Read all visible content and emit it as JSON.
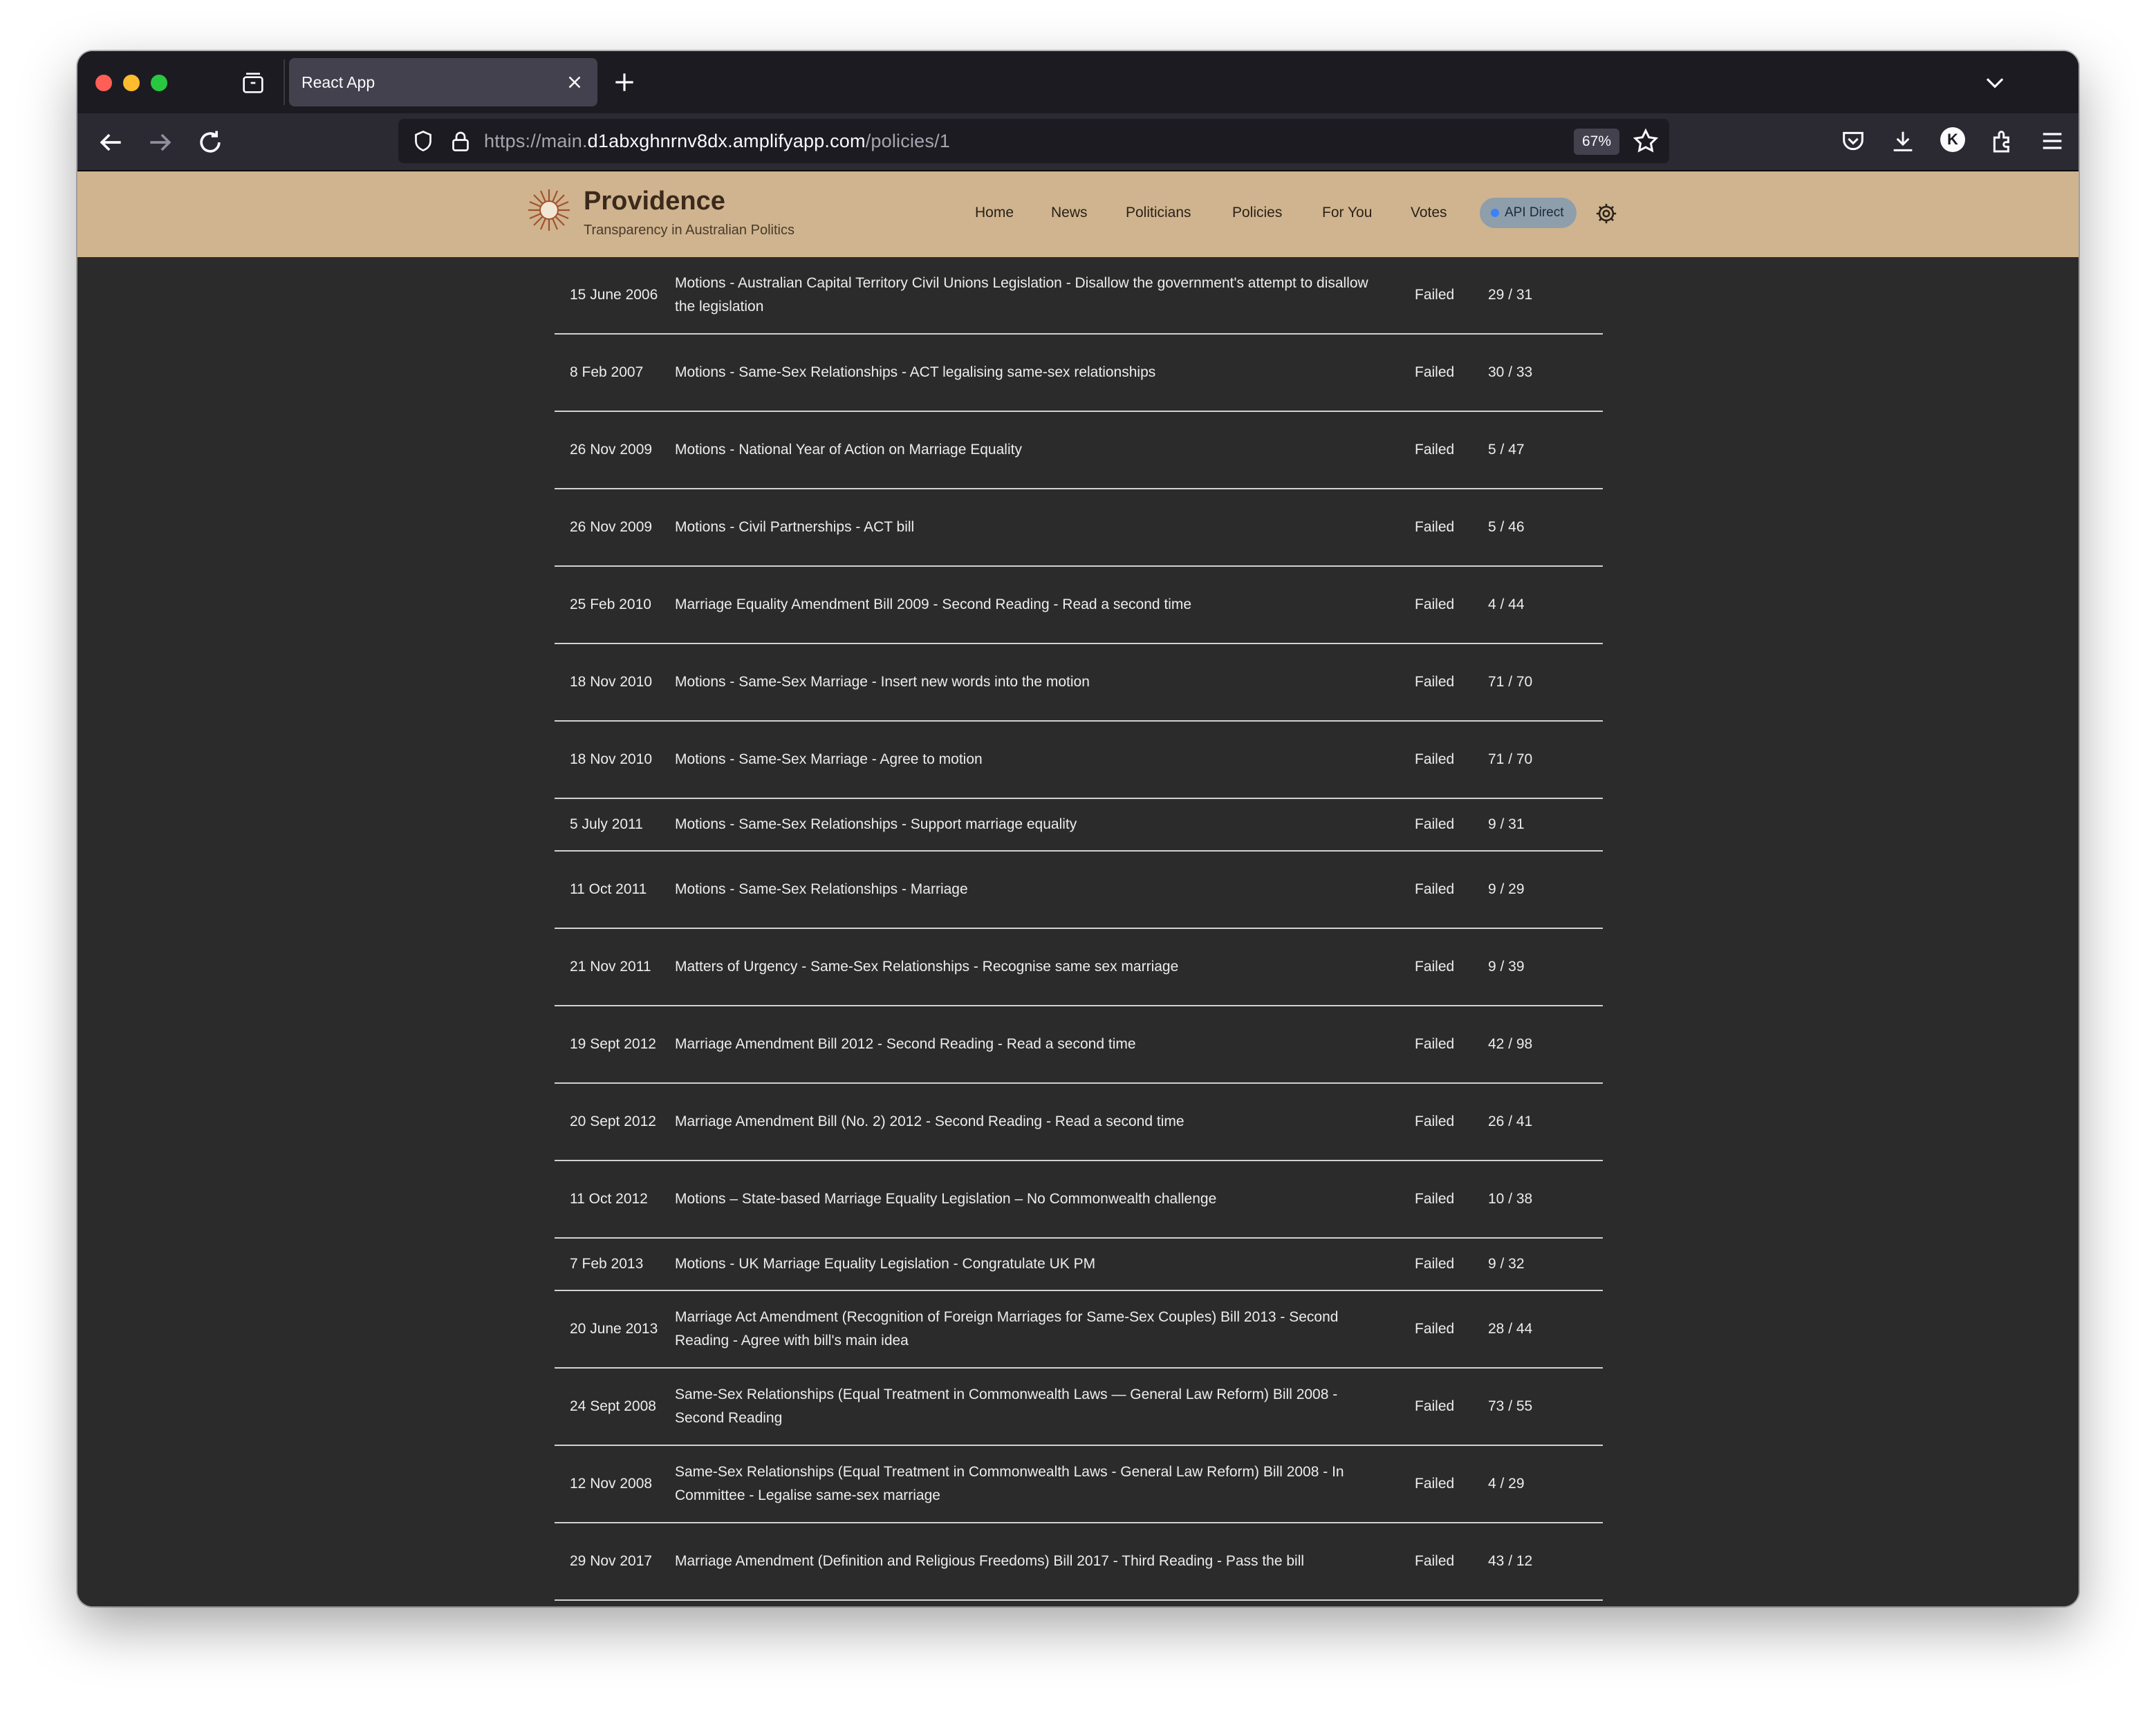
{
  "browser": {
    "tab_title": "React App",
    "url_prefix": "https://main.",
    "url_domain": "d1abxghnrnv8dx.amplifyapp.com",
    "url_path": "/policies/1",
    "zoom": "67%",
    "profile_initial": "K"
  },
  "site": {
    "brand": "Providence",
    "tagline": "Transparency in Australian Politics",
    "nav": [
      "Home",
      "News",
      "Politicians",
      "Policies",
      "For You",
      "Votes"
    ],
    "api_label": "API Direct"
  },
  "votes": [
    {
      "date": "15 June 2006",
      "title": "Motions - Australian Capital Territory Civil Unions Legislation - Disallow the government's attempt to disallow the legislation",
      "result": "Failed",
      "count": "29 / 31"
    },
    {
      "date": "8 Feb 2007",
      "title": "Motions - Same-Sex Relationships - ACT legalising same-sex relationships",
      "result": "Failed",
      "count": "30 / 33"
    },
    {
      "date": "26 Nov 2009",
      "title": "Motions - National Year of Action on Marriage Equality",
      "result": "Failed",
      "count": "5 / 47"
    },
    {
      "date": "26 Nov 2009",
      "title": "Motions - Civil Partnerships - ACT bill",
      "result": "Failed",
      "count": "5 / 46"
    },
    {
      "date": "25 Feb 2010",
      "title": "Marriage Equality Amendment Bill 2009 - Second Reading - Read a second time",
      "result": "Failed",
      "count": "4 / 44"
    },
    {
      "date": "18 Nov 2010",
      "title": "Motions - Same-Sex Marriage - Insert new words into the motion",
      "result": "Failed",
      "count": "71 / 70"
    },
    {
      "date": "18 Nov 2010",
      "title": "Motions - Same-Sex Marriage - Agree to motion",
      "result": "Failed",
      "count": "71 / 70"
    },
    {
      "date": "5 July 2011",
      "title": "Motions - Same-Sex Relationships - Support marriage equality",
      "result": "Failed",
      "count": "9 / 31"
    },
    {
      "date": "11 Oct 2011",
      "title": "Motions - Same-Sex Relationships - Marriage",
      "result": "Failed",
      "count": "9 / 29"
    },
    {
      "date": "21 Nov 2011",
      "title": "Matters of Urgency - Same-Sex Relationships - Recognise same sex marriage",
      "result": "Failed",
      "count": "9 / 39"
    },
    {
      "date": "19 Sept 2012",
      "title": "Marriage Amendment Bill 2012 - Second Reading - Read a second time",
      "result": "Failed",
      "count": "42 / 98"
    },
    {
      "date": "20 Sept 2012",
      "title": "Marriage Amendment Bill (No. 2) 2012 - Second Reading - Read a second time",
      "result": "Failed",
      "count": "26 / 41"
    },
    {
      "date": "11 Oct 2012",
      "title": "Motions – State-based Marriage Equality Legislation – No Commonwealth challenge",
      "result": "Failed",
      "count": "10 / 38"
    },
    {
      "date": "7 Feb 2013",
      "title": "Motions - UK Marriage Equality Legislation - Congratulate UK PM",
      "result": "Failed",
      "count": "9 / 32"
    },
    {
      "date": "20 June 2013",
      "title": "Marriage Act Amendment (Recognition of Foreign Marriages for Same-Sex Couples) Bill 2013 - Second Reading - Agree with bill's main idea",
      "result": "Failed",
      "count": "28 / 44"
    },
    {
      "date": "24 Sept 2008",
      "title": "Same-Sex Relationships (Equal Treatment in Commonwealth Laws — General Law Reform) Bill 2008 - Second Reading",
      "result": "Failed",
      "count": "73 / 55"
    },
    {
      "date": "12 Nov 2008",
      "title": "Same-Sex Relationships (Equal Treatment in Commonwealth Laws - General Law Reform) Bill 2008 - In Committee - Legalise same-sex marriage",
      "result": "Failed",
      "count": "4 / 29"
    },
    {
      "date": "29 Nov 2017",
      "title": "Marriage Amendment (Definition and Religious Freedoms) Bill 2017 - Third Reading - Pass the bill",
      "result": "Failed",
      "count": "43 / 12"
    }
  ]
}
